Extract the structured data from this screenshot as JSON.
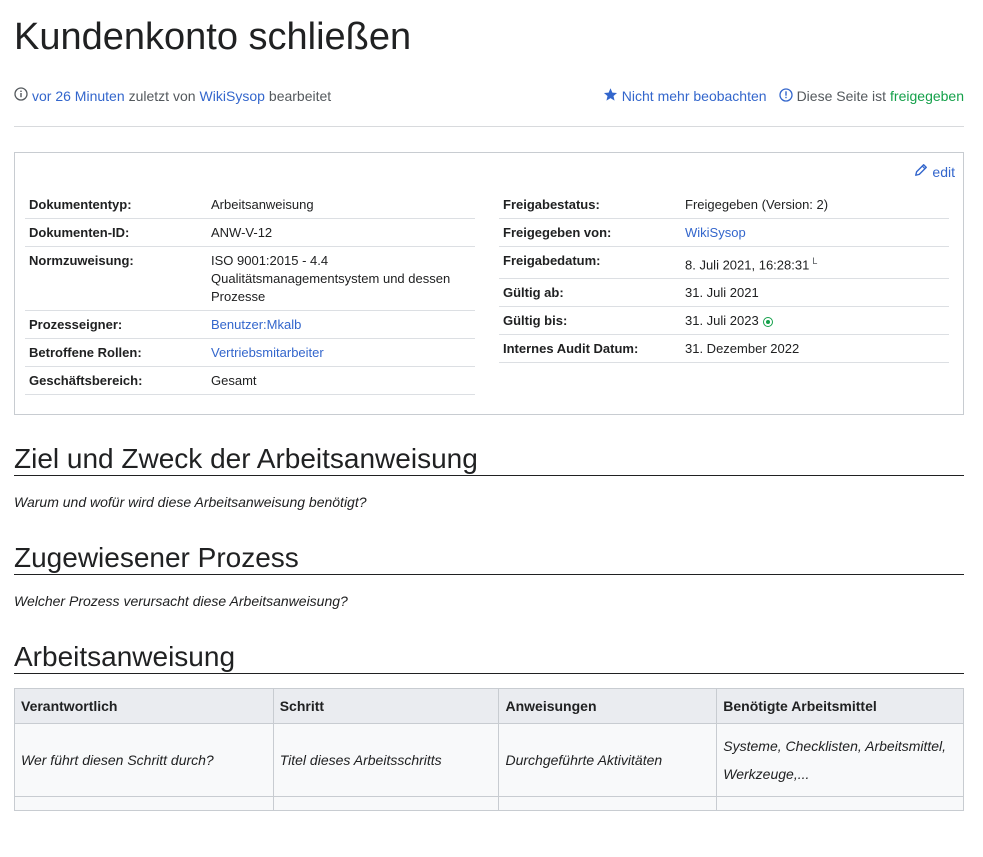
{
  "page": {
    "title": "Kundenkonto schließen"
  },
  "meta": {
    "time_link": "vor 26 Minuten",
    "by_text": "zuletzt von",
    "user_link": "WikiSysop",
    "edited_text": "bearbeitet",
    "watch_link": "Nicht mehr beobachten",
    "status_text": "Diese Seite ist",
    "status_link": "freigegeben"
  },
  "infobox": {
    "edit_label": "edit",
    "left": [
      {
        "key": "Dokumententyp:",
        "value": "Arbeitsanweisung"
      },
      {
        "key": "Dokumenten-ID:",
        "value": "ANW-V-12"
      },
      {
        "key": "Normzuweisung:",
        "value": "ISO 9001:2015 - 4.4 Qualitätsmanagementsystem und dessen Prozesse"
      },
      {
        "key": "Prozesseigner:",
        "value": "Benutzer:Mkalb"
      },
      {
        "key": "Betroffene Rollen:",
        "value": "Vertriebsmitarbeiter"
      },
      {
        "key": "Geschäftsbereich:",
        "value": "Gesamt"
      }
    ],
    "right": [
      {
        "key": "Freigabestatus:",
        "value": "Freigegeben (Version: 2)"
      },
      {
        "key": "Freigegeben von:",
        "value": "WikiSysop"
      },
      {
        "key": "Freigabedatum:",
        "value": "8. Juli 2021, 16:28:31",
        "sup": "L"
      },
      {
        "key": "Gültig ab:",
        "value": "31. Juli 2021"
      },
      {
        "key": "Gültig bis:",
        "value": "31. Juli 2023"
      },
      {
        "key": "Internes Audit Datum:",
        "value": "31. Dezember 2022"
      }
    ]
  },
  "sections": [
    {
      "heading": "Ziel und Zweck der Arbeitsanweisung",
      "text": "Warum und wofür wird diese Arbeitsanweisung benötigt?"
    },
    {
      "heading": "Zugewiesener Prozess",
      "text": "Welcher Prozess verursacht diese Arbeitsanweisung?"
    },
    {
      "heading": "Arbeitsanweisung"
    }
  ],
  "table": {
    "headers": [
      "Verantwortlich",
      "Schritt",
      "Anweisungen",
      "Benötigte Arbeitsmittel"
    ],
    "row": [
      "Wer führt diesen Schritt durch?",
      "Titel dieses Arbeitsschritts",
      "Durchgeführte Aktivitäten",
      "Systeme, Checklisten, Arbeitsmittel, Werkzeuge,..."
    ]
  },
  "colors": {
    "link": "#3366cc",
    "approved": "#14a04a",
    "header_bg": "#eaecf0"
  },
  "icons": [
    "info-icon",
    "star-icon",
    "info-circle-icon",
    "pencil-icon",
    "status-dot-icon"
  ]
}
